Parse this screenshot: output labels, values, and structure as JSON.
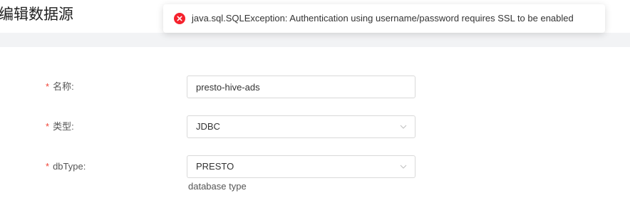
{
  "header": {
    "title": "编辑数据源"
  },
  "toast": {
    "type": "error",
    "icon": "error-circle-icon",
    "message": "java.sql.SQLException: Authentication using username/password requires SSL to be enabled",
    "color": "#f5222d"
  },
  "form": {
    "required_mark": "*",
    "name": {
      "label": "名称:",
      "value": "presto-hive-ads"
    },
    "type": {
      "label": "类型:",
      "value": "JDBC"
    },
    "db_type": {
      "label": "dbType:",
      "value": "PRESTO",
      "help": "database type"
    }
  },
  "colors": {
    "required": "#f04134",
    "border": "#d9d9d9",
    "section_gap": "#f2f3f5"
  }
}
